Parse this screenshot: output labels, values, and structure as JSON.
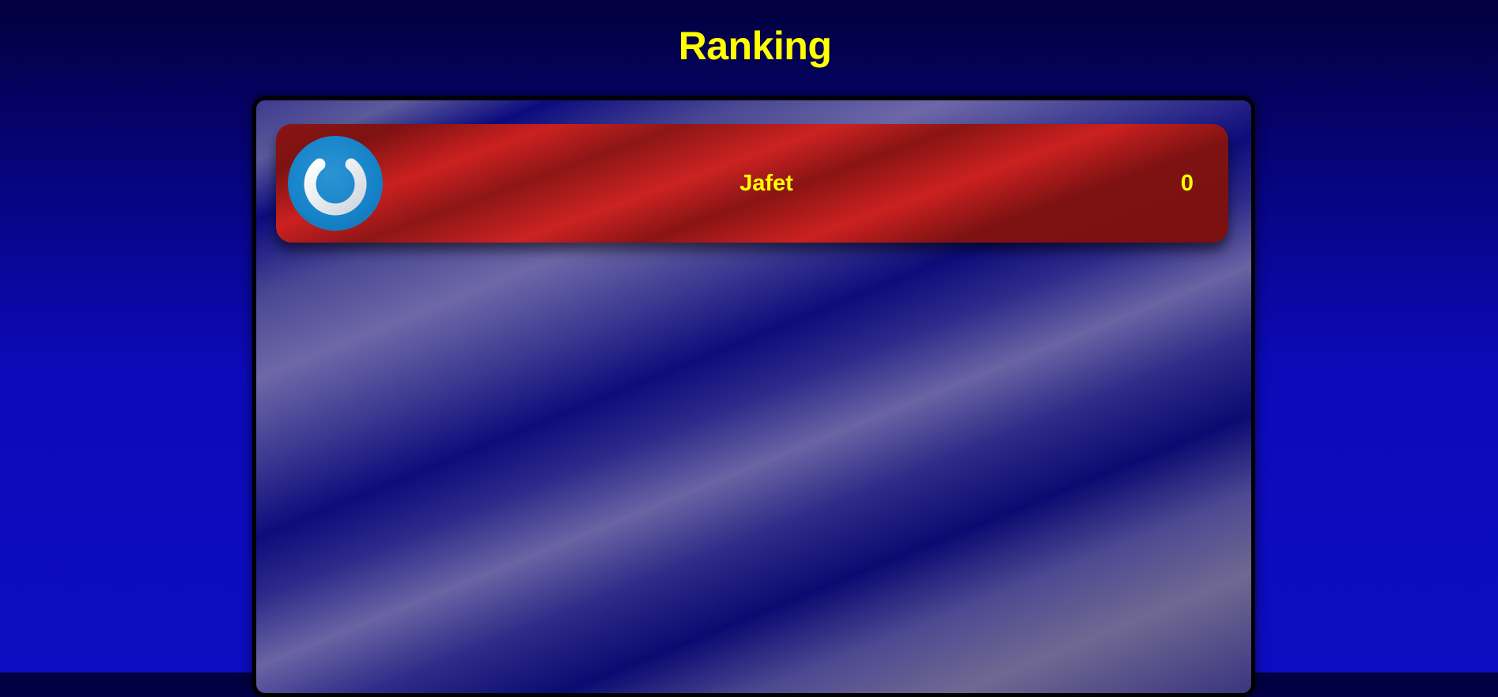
{
  "page": {
    "title": "Ranking"
  },
  "ranking": {
    "rows": [
      {
        "avatar_icon": "power-icon",
        "name": "Jafet",
        "score": "0"
      }
    ]
  },
  "colors": {
    "title": "#ffff00",
    "row_background": "#cc2020",
    "avatar_background": "#1682c8",
    "board_border": "#000000"
  }
}
